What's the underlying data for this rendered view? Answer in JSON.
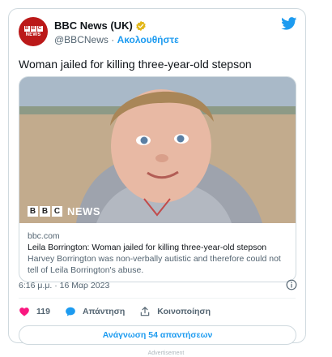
{
  "author": {
    "name": "BBC News (UK)",
    "handle": "@BBCNews",
    "separator": "·",
    "follow_label": "Ακολουθήστε",
    "avatar_letters": [
      "B",
      "B",
      "C"
    ],
    "avatar_word": "NEWS"
  },
  "tweet": {
    "text": "Woman jailed for killing three-year-old stepson"
  },
  "link_card": {
    "brand_letters": [
      "B",
      "B",
      "C"
    ],
    "brand_word": "NEWS",
    "domain": "bbc.com",
    "title": "Leila Borrington: Woman jailed for killing three-year-old stepson",
    "description": "Harvey Borrington was non-verbally autistic and therefore could not tell of Leila Borrington's abuse."
  },
  "timestamp": "6:16 μ.μ. · 16 Μαρ 2023",
  "actions": {
    "like_count": "119",
    "reply_label": "Απάντηση",
    "share_label": "Κοινοποίηση"
  },
  "read_replies_label": "Ανάγνωση 54 απαντήσεων",
  "advertisement_label": "Advertisement",
  "colors": {
    "bbc_red": "#bb1919",
    "twitter_blue": "#1d9bf0",
    "like_pink": "#f91880",
    "muted_text": "#536471"
  },
  "icons": [
    "twitter-bird-icon",
    "verified-badge-icon",
    "info-icon",
    "heart-icon",
    "reply-icon",
    "share-icon"
  ]
}
